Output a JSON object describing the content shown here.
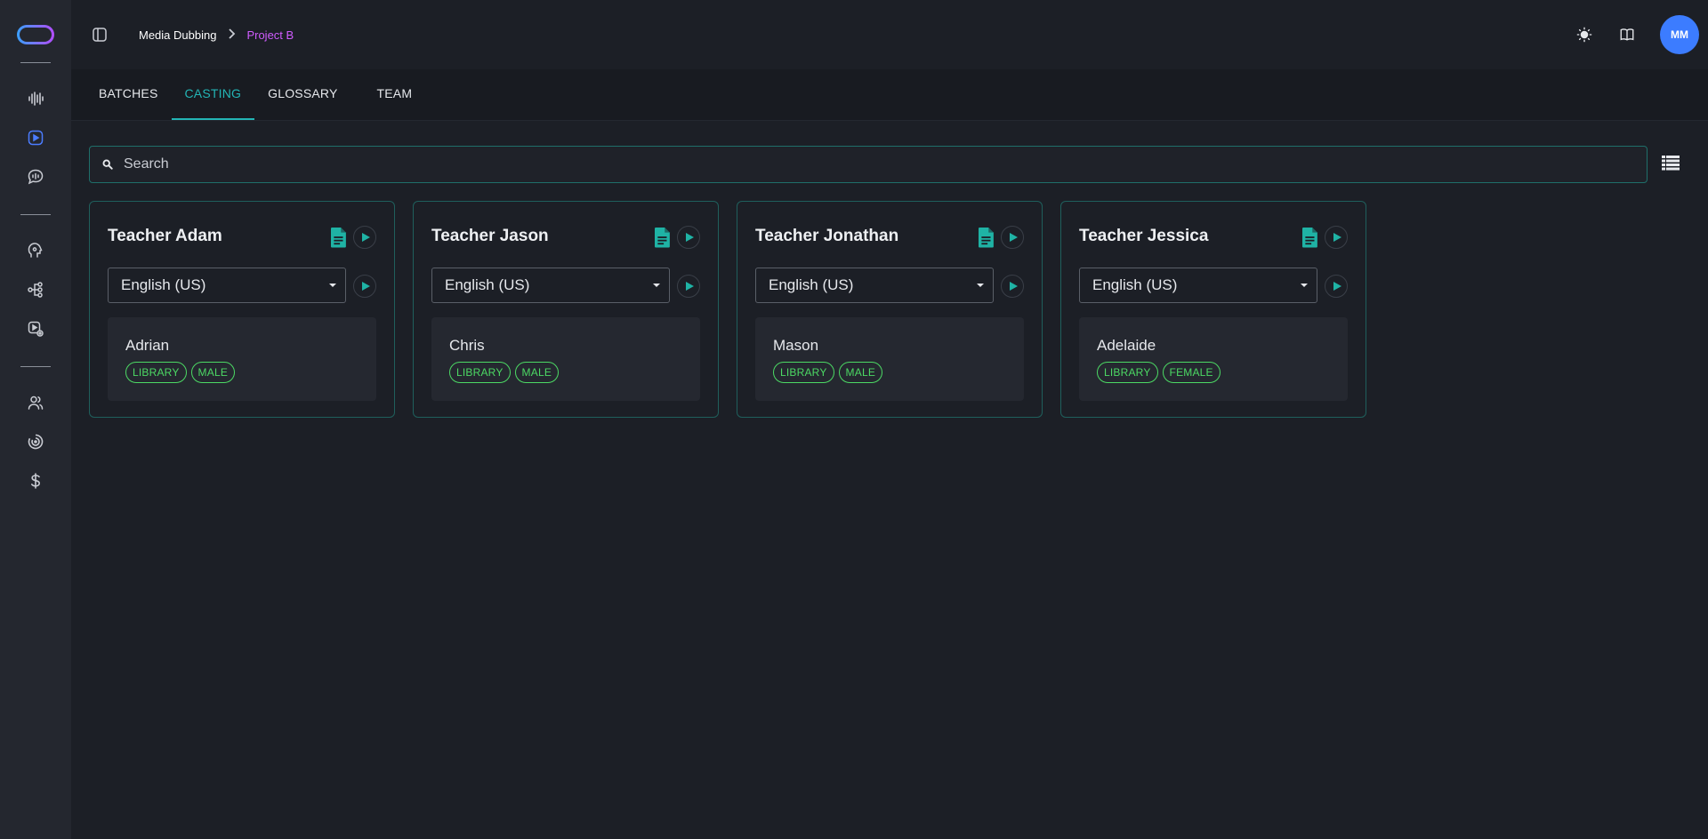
{
  "breadcrumb": {
    "parent": "Media Dubbing",
    "current": "Project B"
  },
  "user": {
    "initials": "MM"
  },
  "tabs": [
    {
      "label": "BATCHES",
      "active": false
    },
    {
      "label": "CASTING",
      "active": true
    },
    {
      "label": "GLOSSARY",
      "active": false
    },
    {
      "label": "TEAM",
      "active": false
    }
  ],
  "search": {
    "placeholder": "Search",
    "value": ""
  },
  "cards": [
    {
      "title": "Teacher Adam",
      "language": "English (US)",
      "voice": "Adrian",
      "tags": [
        "LIBRARY",
        "MALE"
      ]
    },
    {
      "title": "Teacher Jason",
      "language": "English (US)",
      "voice": "Chris",
      "tags": [
        "LIBRARY",
        "MALE"
      ]
    },
    {
      "title": "Teacher Jonathan",
      "language": "English (US)",
      "voice": "Mason",
      "tags": [
        "LIBRARY",
        "MALE"
      ]
    },
    {
      "title": "Teacher Jessica",
      "language": "English (US)",
      "voice": "Adelaide",
      "tags": [
        "LIBRARY",
        "FEMALE"
      ]
    }
  ],
  "colors": {
    "accent": "#23b5b5",
    "breadcrumb_current": "#d05cff",
    "avatar": "#3c7cff",
    "tag": "#4cd964",
    "rail_active": "#4b7cff"
  },
  "icons": {
    "rail": [
      "waveform-icon",
      "video-icon",
      "chat-audio-icon",
      "voice-icon",
      "workflow-icon",
      "media-settings-icon",
      "users-icon",
      "analytics-icon",
      "dollar-icon"
    ],
    "top": [
      "sun-icon",
      "book-icon"
    ]
  }
}
